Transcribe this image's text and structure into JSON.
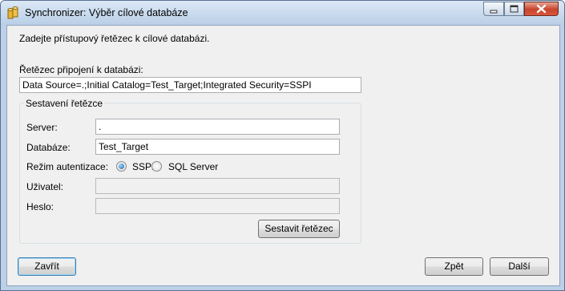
{
  "window": {
    "title": "Synchronizer: Výběr cílové databáze"
  },
  "intro": "Zadejte přístupový řetězec k cílové databázi.",
  "connection": {
    "label": "Řetězec připojení k databázi:",
    "value": "Data Source=.;Initial Catalog=Test_Target;Integrated Security=SSPI"
  },
  "builder": {
    "title": "Sestavení řetězce",
    "server_label": "Server:",
    "server_value": ".",
    "database_label": "Databáze:",
    "database_value": "Test_Target",
    "auth_label": "Režim autentizace:",
    "auth_options": [
      {
        "label": "SSPI",
        "selected": true
      },
      {
        "label": "SQL Server",
        "selected": false
      }
    ],
    "user_label": "Uživatel:",
    "user_value": "",
    "password_label": "Heslo:",
    "password_value": "",
    "build_button": "Sestavit řetězec"
  },
  "footer": {
    "close_button": "Zavřít",
    "back_button": "Zpět",
    "next_button": "Další"
  },
  "icons": {
    "app": "database-cylinders-icon",
    "minimize": "minimize-icon",
    "maximize": "maximize-icon",
    "close": "close-icon"
  }
}
